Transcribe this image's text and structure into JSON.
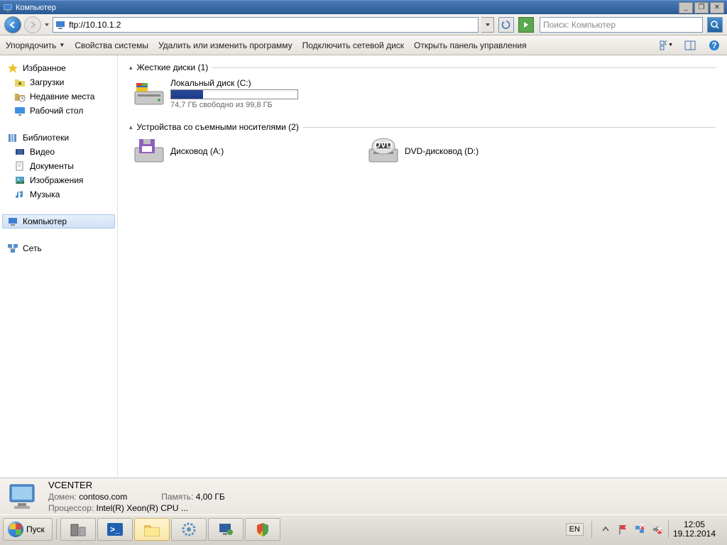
{
  "window": {
    "title": "Компьютер"
  },
  "nav": {
    "address": "ftp://10.10.1.2",
    "search_placeholder": "Поиск: Компьютер"
  },
  "toolbar": {
    "organize": "Упорядочить",
    "sysprops": "Свойства системы",
    "uninstall": "Удалить или изменить программу",
    "mapdrive": "Подключить сетевой диск",
    "ctrlpanel": "Открыть панель управления"
  },
  "sidebar": {
    "favorites": {
      "header": "Избранное",
      "items": [
        "Загрузки",
        "Недавние места",
        "Рабочий стол"
      ]
    },
    "libraries": {
      "header": "Библиотеки",
      "items": [
        "Видео",
        "Документы",
        "Изображения",
        "Музыка"
      ]
    },
    "computer": "Компьютер",
    "network": "Сеть"
  },
  "content": {
    "hdd_header": "Жесткие диски (1)",
    "hdd": {
      "name": "Локальный диск (C:)",
      "free_text": "74,7 ГБ свободно из 99,8 ГБ",
      "fill_pct": 25
    },
    "removable_header": "Устройства со съемными носителями (2)",
    "floppy": "Дисковод (A:)",
    "dvd": "DVD-дисковод (D:)"
  },
  "details": {
    "hostname": "VCENTER",
    "domain_k": "Домен:",
    "domain_v": "contoso.com",
    "cpu_k": "Процессор:",
    "cpu_v": "Intel(R) Xeon(R) CPU    ...",
    "mem_k": "Память:",
    "mem_v": "4,00 ГБ"
  },
  "taskbar": {
    "start": "Пуск",
    "lang": "EN",
    "time": "12:05",
    "date": "19.12.2014"
  }
}
